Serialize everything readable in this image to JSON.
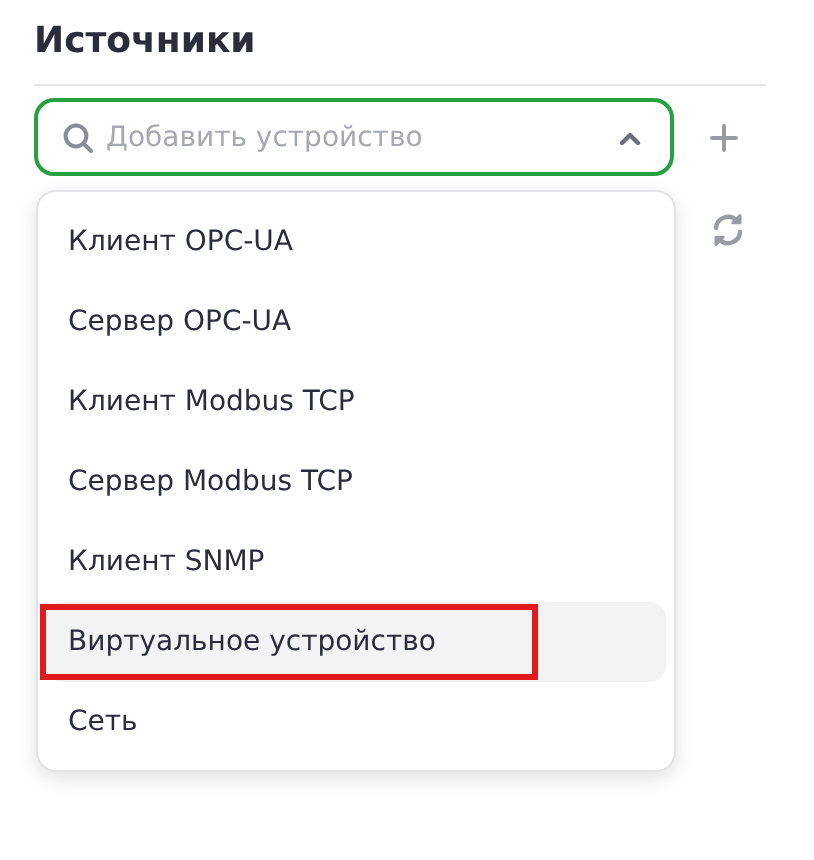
{
  "panel": {
    "title": "Источники"
  },
  "device_select": {
    "placeholder": "Добавить устройство",
    "expanded": true
  },
  "options": [
    {
      "label": "Клиент OPC-UA",
      "hovered": false,
      "highlighted": false
    },
    {
      "label": "Сервер OPC-UA",
      "hovered": false,
      "highlighted": false
    },
    {
      "label": "Клиент Modbus TCP",
      "hovered": false,
      "highlighted": false
    },
    {
      "label": "Сервер Modbus TCP",
      "hovered": false,
      "highlighted": false
    },
    {
      "label": "Клиент SNMP",
      "hovered": false,
      "highlighted": false
    },
    {
      "label": "Виртуальное устройство",
      "hovered": true,
      "highlighted": true
    },
    {
      "label": "Сеть",
      "hovered": false,
      "highlighted": false
    }
  ]
}
